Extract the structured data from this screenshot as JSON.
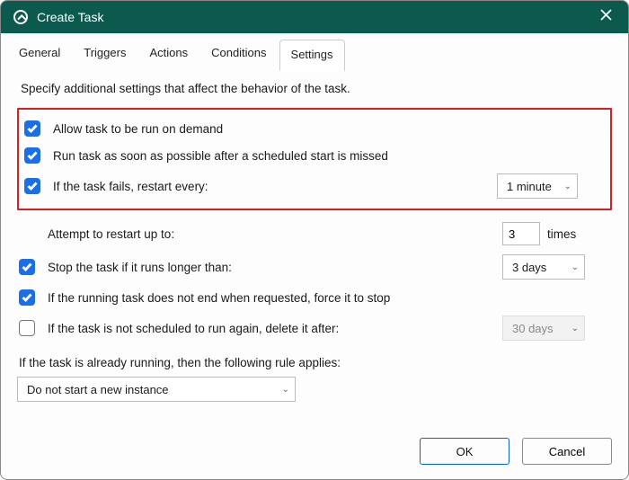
{
  "titlebar": {
    "title": "Create Task"
  },
  "tabs": {
    "t0": "General",
    "t1": "Triggers",
    "t2": "Actions",
    "t3": "Conditions",
    "t4": "Settings"
  },
  "desc": "Specify additional settings that affect the behavior of the task.",
  "opts": {
    "allow_on_demand": "Allow task to be run on demand",
    "run_asap": "Run task as soon as possible after a scheduled start is missed",
    "restart_every": "If the task fails, restart every:",
    "restart_interval": "1 minute",
    "attempt_label": "Attempt to restart up to:",
    "attempt_count": "3",
    "attempt_suffix": "times",
    "stop_longer": "Stop the task if it runs longer than:",
    "stop_longer_val": "3 days",
    "force_stop": "If the running task does not end when requested, force it to stop",
    "delete_after": "If the task is not scheduled to run again, delete it after:",
    "delete_after_val": "30 days",
    "rule_label": "If the task is already running, then the following rule applies:",
    "rule_val": "Do not start a new instance"
  },
  "buttons": {
    "ok": "OK",
    "cancel": "Cancel"
  }
}
